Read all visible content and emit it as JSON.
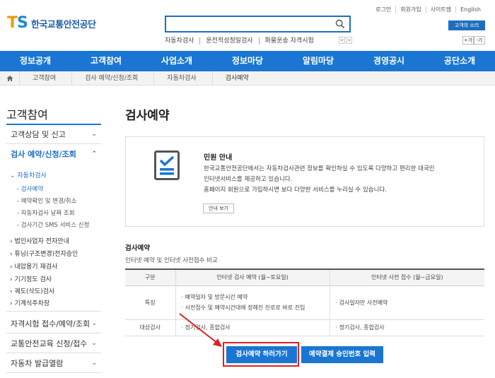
{
  "header": {
    "top_links": [
      "로그인",
      "회원가입",
      "사이트맵",
      "English"
    ],
    "logo_mark_t": "T",
    "logo_mark_s": "S",
    "logo_text": "한국교통안전공단",
    "search_placeholder": "",
    "keywords": [
      "자동차검사",
      "운전적성정밀검사",
      "화물운송 자격시험"
    ],
    "kw_prev": "<",
    "kw_next": ">",
    "voice_button": "고객의 소리",
    "font_plus": "+가",
    "font_minus": "-가"
  },
  "gnb": [
    "정보공개",
    "고객참여",
    "사업소개",
    "정보마당",
    "알림마당",
    "경영공시",
    "공단소개"
  ],
  "breadcrumb": [
    "고객참여",
    "검사 예약/신청/조회",
    "자동차검사",
    "검사예약"
  ],
  "sidebar": {
    "title": "고객참여",
    "items_top": [
      {
        "label": "고객상담 및 신고",
        "chev": "⌄"
      },
      {
        "label": "검사 예약/신청/조회",
        "chev": "⌃"
      }
    ],
    "sub_auto": "자동차검사",
    "sub_auto_items": [
      "검사예약",
      "예약확인 및 변경/취소",
      "자동차검사 날짜 조회",
      "검사기간 SMS 서비스 신청"
    ],
    "sub_other": [
      "법인사업자 전자안내",
      "튜닝(구조변경)전자승인",
      "내압용기 재검사",
      "기기정도 검사",
      "궤도(삭도)검사",
      "기계식주차장"
    ],
    "items_bottom": [
      {
        "label": "자격시험 접수/예약/조회",
        "chev": "⌄"
      },
      {
        "label": "교통안전교육 신청/접수",
        "chev": "⌄"
      },
      {
        "label": "자동차 발급열람",
        "chev": "⌄"
      }
    ]
  },
  "main": {
    "title": "검사예약",
    "info": {
      "title": "민원 안내",
      "lines": [
        "한국교통안전공단에서는 자동차검사관련 정보를 확인하실 수 있도록 다양하고 편리한 대국민",
        "인터넷서비스를 제공하고 있습니다.",
        "홈페이지 회원으로 가입하시면 보다 다양한 서비스를 누리실 수 있습니다."
      ],
      "guide_button": "안내 보기"
    },
    "section_title": "검사예약",
    "section_sub": "인터넷 예약 및 인터넷 사전접수 비교",
    "table": {
      "headers": [
        "구분",
        "인터넷 검사 예약 (월~토요일)",
        "인터넷 사전 접수 (월~금요일)"
      ],
      "rows": [
        {
          "label": "특징",
          "col1": [
            "예약일자 및 방문시간 예약",
            "사전접수 및 예약시간대에 정해진 진로로 바로 진입"
          ],
          "col2": [
            "검사일자만 사전예약"
          ]
        },
        {
          "label": "대상검사",
          "col1": [
            "정기검사, 종합검사"
          ],
          "col2": [
            "정기검사, 종합검사"
          ]
        }
      ]
    },
    "buttons": {
      "reserve": "검사예약 하러가기",
      "payment": "예약결제 승인번호 입력"
    }
  },
  "colors": {
    "primary": "#1a76d2",
    "accent_orange": "#f39a00",
    "highlight_red": "#e02020"
  }
}
